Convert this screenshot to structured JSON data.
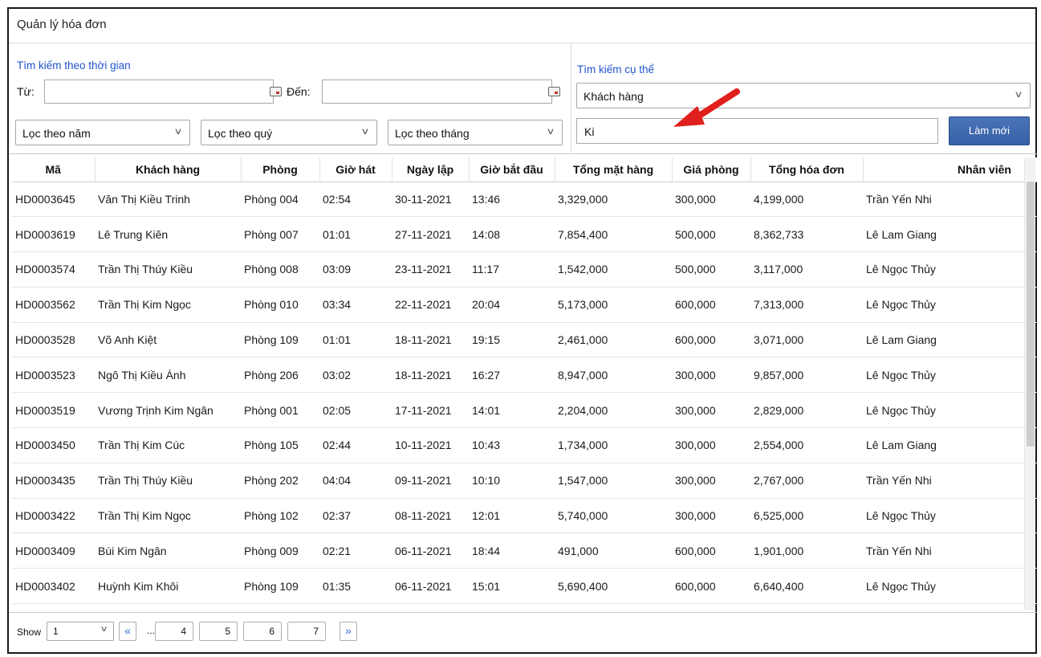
{
  "window": {
    "title": "Quản lý hóa đơn"
  },
  "time_search": {
    "label": "Tìm kiếm theo thời gian",
    "from_label": "Từ:",
    "from_value": "",
    "to_label": "Đến:",
    "to_value": "",
    "year_filter": "Lọc theo năm",
    "quarter_filter": "Lọc theo quý",
    "month_filter": "Lọc theo tháng"
  },
  "specific_search": {
    "label": "Tìm kiếm cụ thể",
    "field_selected": "Khách hàng",
    "query_value": "Ki",
    "refresh_label": "Làm mới"
  },
  "table": {
    "columns": [
      "Mã",
      "Khách hàng",
      "Phòng",
      "Giờ hát",
      "Ngày lập",
      "Giờ bắt đầu",
      "Tổng mặt hàng",
      "Giá phòng",
      "Tổng hóa đơn",
      "Nhân viên"
    ],
    "rows": [
      [
        "HD0003645",
        "Văn Thị Kiều Trinh",
        "Phòng 004",
        "02:54",
        "30-11-2021",
        "13:46",
        "3,329,000",
        "300,000",
        "4,199,000",
        "Trần Yến Nhi"
      ],
      [
        "HD0003619",
        "Lê Trung Kiên",
        "Phòng 007",
        "01:01",
        "27-11-2021",
        "14:08",
        "7,854,400",
        "500,000",
        "8,362,733",
        "Lê Lam Giang"
      ],
      [
        "HD0003574",
        "Trần Thị Thúy Kiều",
        "Phòng 008",
        "03:09",
        "23-11-2021",
        "11:17",
        "1,542,000",
        "500,000",
        "3,117,000",
        "Lê Ngọc Thủy"
      ],
      [
        "HD0003562",
        "Trần Thị Kim Ngọc",
        "Phòng 010",
        "03:34",
        "22-11-2021",
        "20:04",
        "5,173,000",
        "600,000",
        "7,313,000",
        "Lê Ngọc Thủy"
      ],
      [
        "HD0003528",
        "Võ Anh Kiệt",
        "Phòng 109",
        "01:01",
        "18-11-2021",
        "19:15",
        "2,461,000",
        "600,000",
        "3,071,000",
        "Lê Lam Giang"
      ],
      [
        "HD0003523",
        "Ngô Thị Kiều Ánh",
        "Phòng 206",
        "03:02",
        "18-11-2021",
        "16:27",
        "8,947,000",
        "300,000",
        "9,857,000",
        "Lê Ngọc Thủy"
      ],
      [
        "HD0003519",
        "Vương Trịnh Kim Ngân",
        "Phòng 001",
        "02:05",
        "17-11-2021",
        "14:01",
        "2,204,000",
        "300,000",
        "2,829,000",
        "Lê Ngọc Thủy"
      ],
      [
        "HD0003450",
        "Trần Thị Kim Cúc",
        "Phòng 105",
        "02:44",
        "10-11-2021",
        "10:43",
        "1,734,000",
        "300,000",
        "2,554,000",
        "Lê Lam Giang"
      ],
      [
        "HD0003435",
        "Trần Thị Thúy Kiều",
        "Phòng 202",
        "04:04",
        "09-11-2021",
        "10:10",
        "1,547,000",
        "300,000",
        "2,767,000",
        "Trần Yến Nhi"
      ],
      [
        "HD0003422",
        "Trần Thị Kim Ngọc",
        "Phòng 102",
        "02:37",
        "08-11-2021",
        "12:01",
        "5,740,000",
        "300,000",
        "6,525,000",
        "Lê Ngọc Thủy"
      ],
      [
        "HD0003409",
        "Bùi Kim Ngân",
        "Phòng 009",
        "02:21",
        "06-11-2021",
        "18:44",
        "491,000",
        "600,000",
        "1,901,000",
        "Trần Yến Nhi"
      ],
      [
        "HD0003402",
        "Huỳnh Kim Khôi",
        "Phòng 109",
        "01:35",
        "06-11-2021",
        "15:01",
        "5,690,400",
        "600,000",
        "6,640,400",
        "Lê Ngọc Thủy"
      ]
    ]
  },
  "pagination": {
    "show_label": "Show",
    "page_selected": "1",
    "prev_icon": "«",
    "ellipsis": "...",
    "pages": [
      "4",
      "5",
      "6",
      "7"
    ],
    "next_icon": "»"
  },
  "icons": {
    "calendar": "calendar-icon",
    "chevron": "chevron-down-icon",
    "annotation_arrow": "red-arrow"
  },
  "colors": {
    "section_label": "#2255cc",
    "button": "#3c66ad",
    "arrow": "#e0201c"
  }
}
